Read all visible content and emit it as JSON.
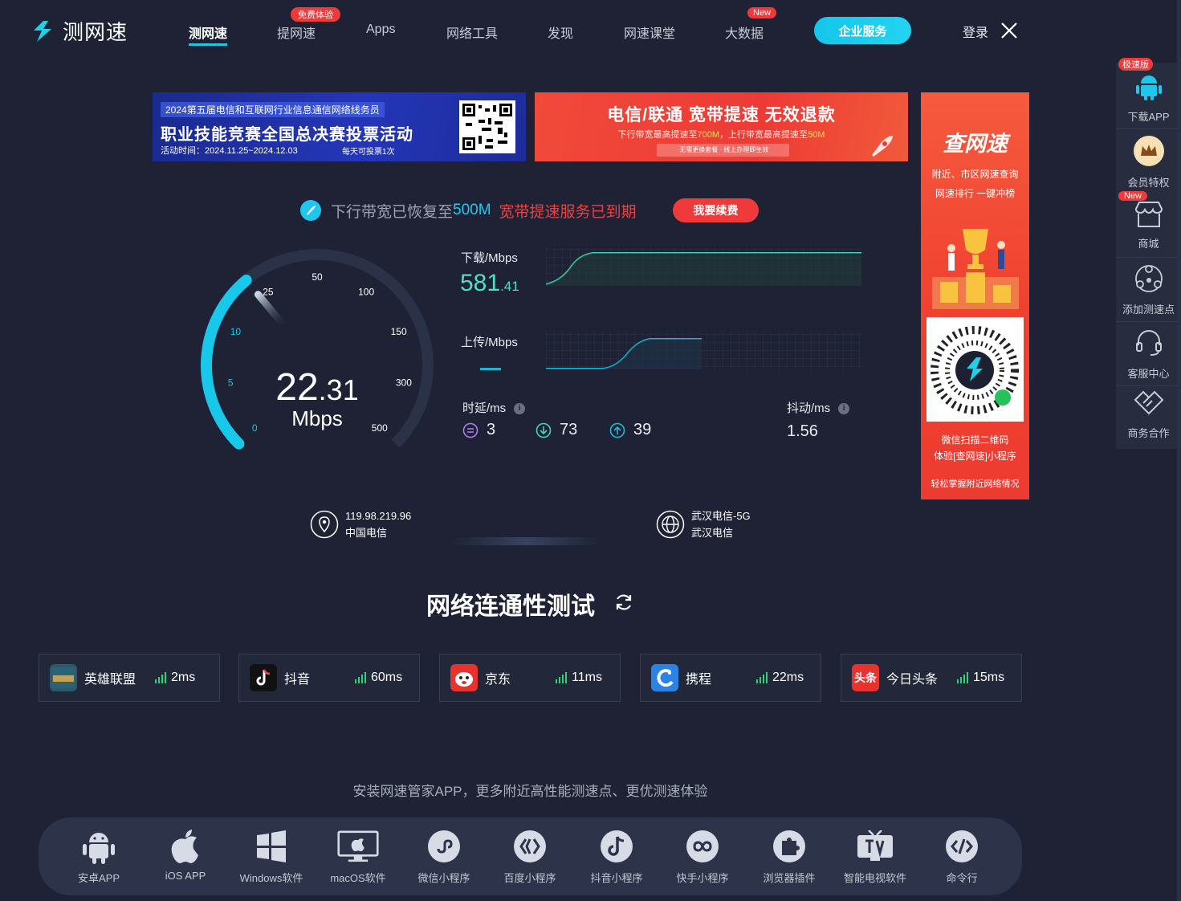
{
  "brand": {
    "name": "测网速"
  },
  "nav": {
    "items": [
      "测网速",
      "提网速",
      "Apps",
      "网络工具",
      "发现",
      "网速课堂",
      "大数据"
    ],
    "badge_free": "免费体验",
    "badge_new": "New",
    "enterprise": "企业服务",
    "login": "登录"
  },
  "banners": {
    "b1_tag": "2024第五届电信和互联网行业信息通信网络线务员",
    "b1_title": "职业技能竞赛全国总决赛投票活动",
    "b1_time": "活动时间：2024.11.25~2024.12.03",
    "b1_note": "每天可投票1次",
    "b2_title": "电信/联通 宽带提速 无效退款",
    "b2_line_a": "下行带宽最高提速至",
    "b2_val_a": "700M",
    "b2_line_b": "，上行带宽最高提速至",
    "b2_val_b": "50M",
    "b2_pill": "·无需更换套餐 · 线上办理即生效",
    "b3_title": "查网速",
    "b3_line1": "附近、市区网速查询",
    "b3_line2": "网速排行  一键冲榜",
    "b3_scan1": "微信扫描二维码",
    "b3_scan2": "体验[查网速]小程序",
    "b3_foot": "轻松掌握附近网络情况"
  },
  "status": {
    "restored": "下行带宽已恢复至",
    "restored_value": "500M",
    "expired": "宽带提速服务已到期",
    "renew_button": "我要续费"
  },
  "gauge": {
    "ticks": [
      "0",
      "5",
      "10",
      "25",
      "50",
      "100",
      "150",
      "300",
      "500"
    ],
    "current_int": "22",
    "current_dec": ".31",
    "unit": "Mbps",
    "current_value": 22.31
  },
  "results": {
    "download_label": "下载/Mbps",
    "download_int": "581",
    "download_dec": ".41",
    "upload_label": "上传/Mbps",
    "latency_label": "时延/ms",
    "latency_idle": "3",
    "latency_down": "73",
    "latency_up": "39",
    "jitter_label": "抖动/ms",
    "jitter": "1.56"
  },
  "connection": {
    "ip": "119.98.219.96",
    "isp": "中国电信",
    "server": "武汉电信-5G",
    "server_isp": "武汉电信"
  },
  "connectivity": {
    "title": "网络连通性测试",
    "items": [
      {
        "name": "英雄联盟",
        "latency": "2ms",
        "color": "#2a5a6a"
      },
      {
        "name": "抖音",
        "latency": "60ms",
        "color": "#111111"
      },
      {
        "name": "京东",
        "latency": "11ms",
        "color": "#e8322d"
      },
      {
        "name": "携程",
        "latency": "22ms",
        "color": "#2a84e6"
      },
      {
        "name": "今日头条",
        "latency": "15ms",
        "color": "#e8322d"
      }
    ],
    "toutiao_badge": "头条"
  },
  "install": {
    "tip": "安装网速管家APP，更多附近高性能测速点、更优测速体验",
    "apps": [
      "安卓APP",
      "iOS APP",
      "Windows软件",
      "macOS软件",
      "微信小程序",
      "百度小程序",
      "抖音小程序",
      "快手小程序",
      "浏览器插件",
      "智能电视软件",
      "命令行"
    ]
  },
  "sidebar": {
    "badge_speed": "极速版",
    "download_app": "下载APP",
    "vip": "会员特权",
    "badge_new": "New",
    "shop": "商城",
    "add_node": "添加测速点",
    "support": "客服中心",
    "business": "商务合作"
  },
  "colors": {
    "accent": "#18c8ea",
    "alert": "#ef3a3a",
    "download_green": "#4fe0c4",
    "background": "#1e2234"
  }
}
